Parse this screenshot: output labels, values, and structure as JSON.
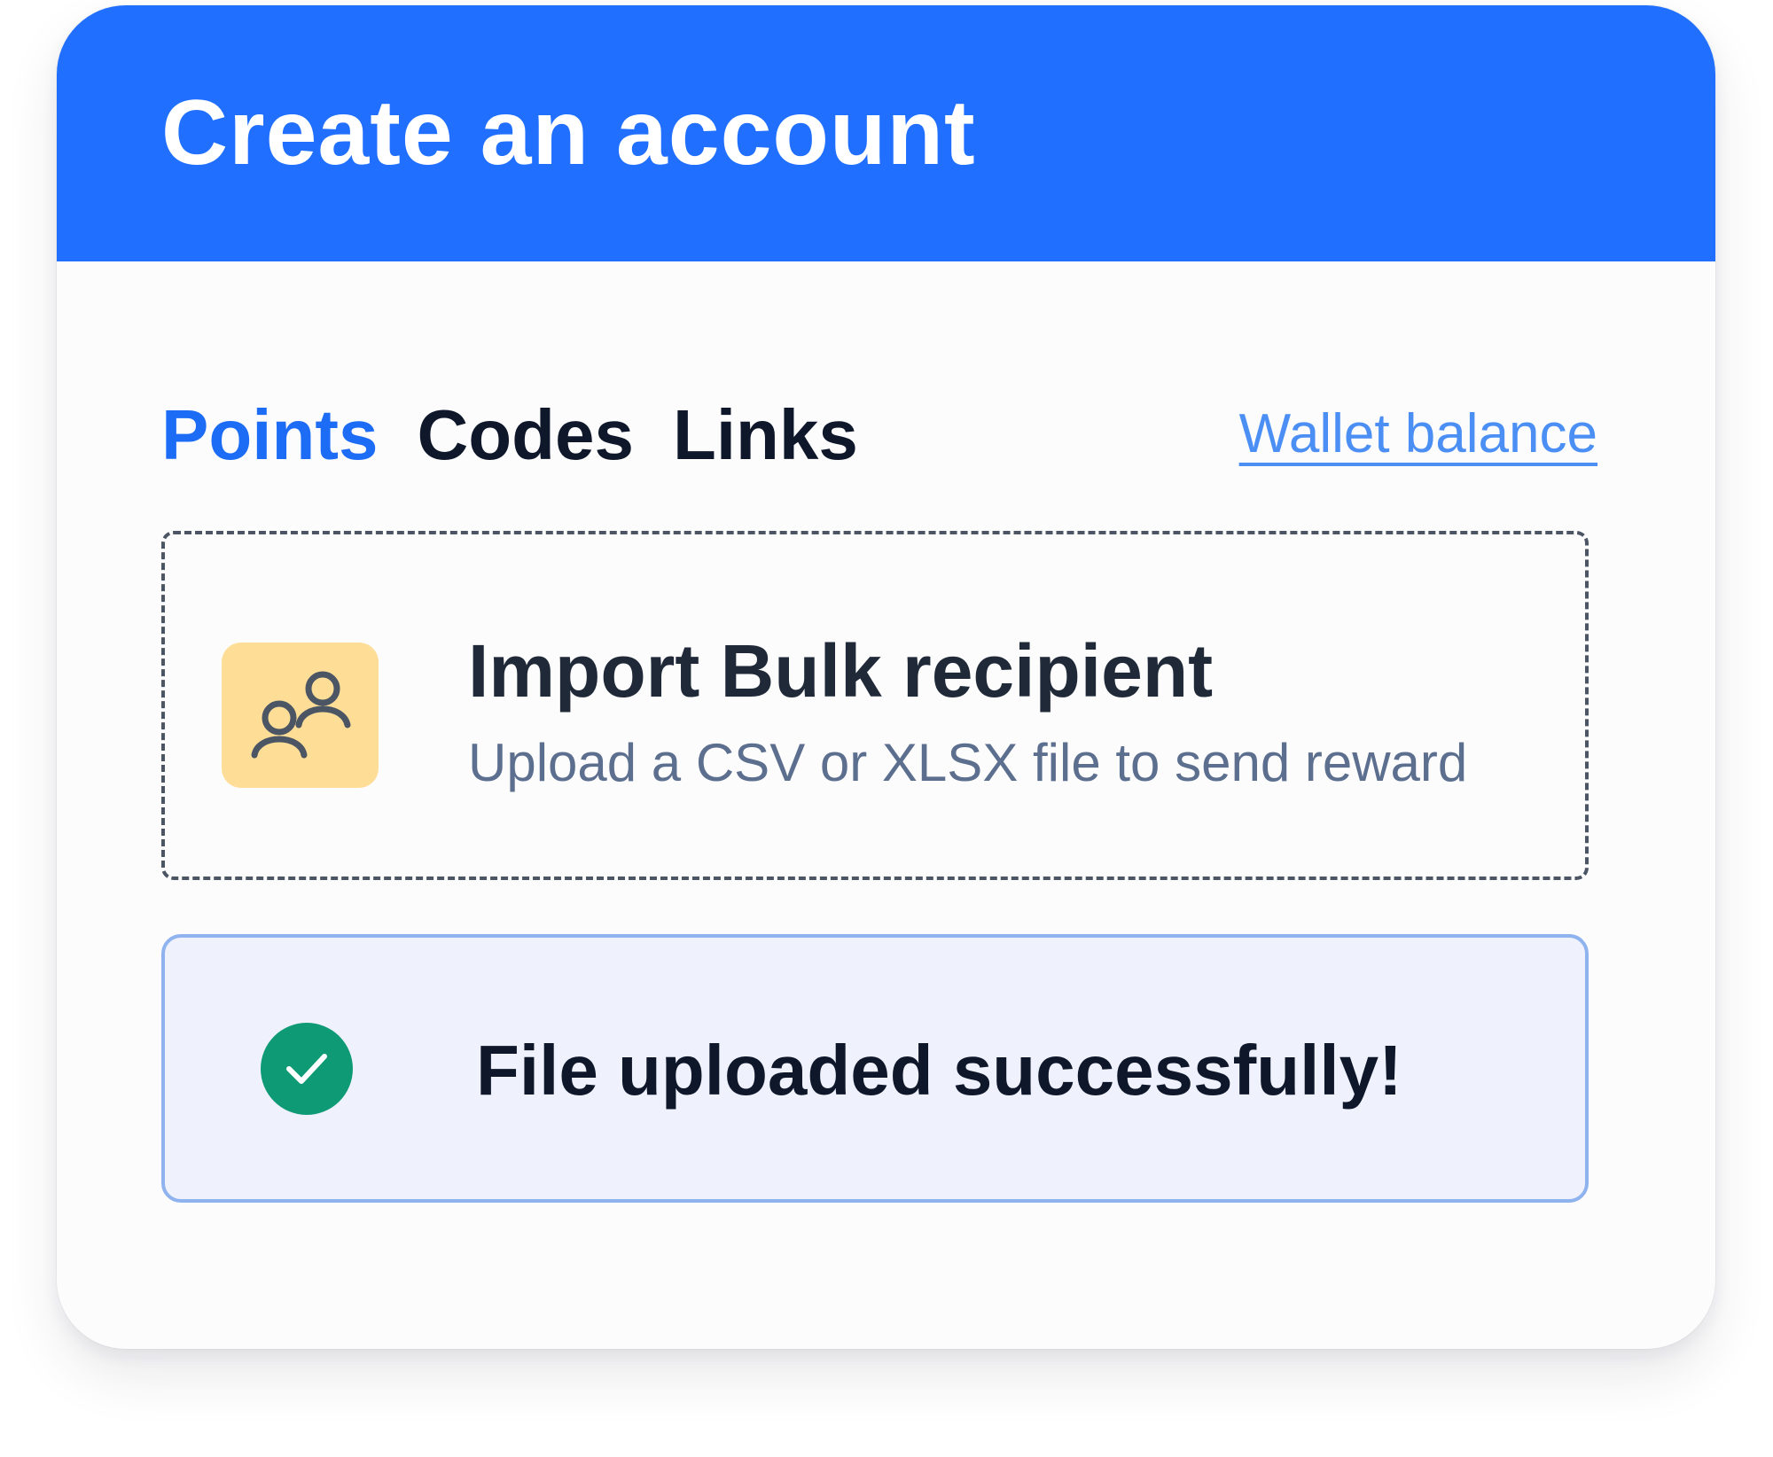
{
  "header": {
    "title": "Create an account"
  },
  "tabs": [
    {
      "label": "Points",
      "active": true
    },
    {
      "label": "Codes",
      "active": false
    },
    {
      "label": "Links",
      "active": false
    }
  ],
  "wallet_link": "Wallet balance",
  "dropzone": {
    "icon": "users-icon",
    "title": "Import Bulk recipient",
    "subtitle": "Upload a CSV or XLSX file to send reward"
  },
  "success": {
    "icon": "check-circle-icon",
    "message": "File uploaded successfully!"
  },
  "colors": {
    "header": "#206fff",
    "active_tab": "#1d6cf6",
    "link": "#4b8ff5",
    "icon_bg": "#fedd97",
    "success_bg": "#eff2fd",
    "success_border": "#8fb3ef",
    "success_icon": "#0e9a74"
  }
}
